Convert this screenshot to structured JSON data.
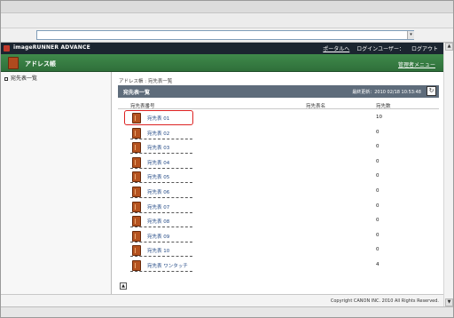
{
  "browser": {
    "address_value": "",
    "dropdown_glyph": "▾"
  },
  "app": {
    "brand": "imageRUNNER ADVANCE",
    "portal_link": "ポータルへ",
    "login_user": "ログインユーザー：",
    "logout": "ログアウト"
  },
  "page": {
    "title": "アドレス帳",
    "admin_menu": "管理者メニュー"
  },
  "sidebar": {
    "items": [
      {
        "label": "宛先表一覧"
      }
    ]
  },
  "main": {
    "breadcrumb": "アドレス帳 : 宛先表一覧",
    "list_title": "宛先表一覧",
    "last_updated": "最終更新：2010 02/18 10:53:48",
    "columns": {
      "list_name": "宛先表番号",
      "list_label": "宛先表名",
      "count": "宛先数"
    },
    "rows": [
      {
        "name": "宛先表 01",
        "count": "10",
        "selected": true
      },
      {
        "name": "宛先表 02",
        "count": "0"
      },
      {
        "name": "宛先表 03",
        "count": "0"
      },
      {
        "name": "宛先表 04",
        "count": "0"
      },
      {
        "name": "宛先表 05",
        "count": "0"
      },
      {
        "name": "宛先表 06",
        "count": "0"
      },
      {
        "name": "宛先表 07",
        "count": "0"
      },
      {
        "name": "宛先表 08",
        "count": "0"
      },
      {
        "name": "宛先表 09",
        "count": "0"
      },
      {
        "name": "宛先表 10",
        "count": "0"
      },
      {
        "name": "宛先表 ワンタッチ",
        "count": "4"
      }
    ]
  },
  "footer": {
    "copyright": "Copyright CANON INC. 2010 All Rights Reserved."
  },
  "colors": {
    "header_dark": "#1b2530",
    "page_header_green": "#3f8a4b",
    "list_bar": "#5e6c7b",
    "highlight": "#dd2222",
    "book_icon": "#b4521f"
  },
  "icons": {
    "refresh": "refresh-icon",
    "book": "address-book-icon",
    "page_top": "page-top-icon"
  }
}
